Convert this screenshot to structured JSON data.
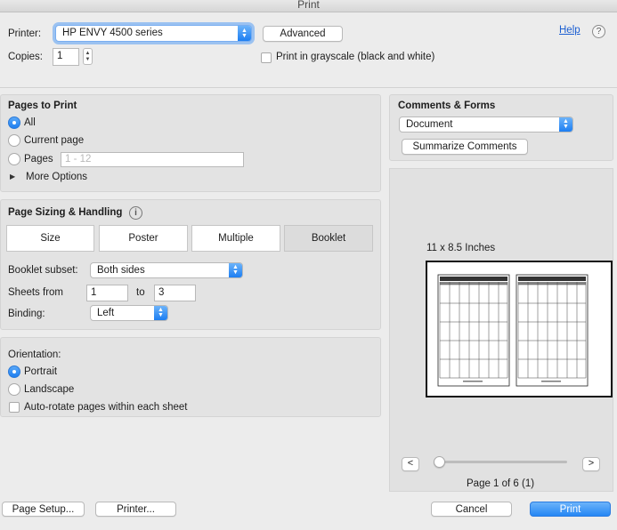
{
  "window": {
    "title": "Print"
  },
  "top": {
    "printer_label": "Printer:",
    "printer_value": "HP ENVY 4500 series",
    "advanced_label": "Advanced",
    "help_label": "Help",
    "help_icon": "?",
    "copies_label": "Copies:",
    "copies_value": "1",
    "grayscale_label": "Print in grayscale (black and white)",
    "grayscale_checked": false
  },
  "pages_to_print": {
    "heading": "Pages to Print",
    "all_label": "All",
    "current_label": "Current page",
    "pages_label": "Pages",
    "pages_placeholder": "1 - 12",
    "more_options_label": "More Options",
    "selected": "All"
  },
  "sizing": {
    "heading": "Page Sizing & Handling",
    "info_icon": "i",
    "tabs": [
      "Size",
      "Poster",
      "Multiple",
      "Booklet"
    ],
    "selected_tab": "Booklet",
    "booklet_subset_label": "Booklet subset:",
    "booklet_subset_value": "Both sides",
    "sheets_from_label": "Sheets from",
    "sheets_from_value": "1",
    "to_label": "to",
    "sheets_to_value": "3",
    "binding_label": "Binding:",
    "binding_value": "Left"
  },
  "orientation": {
    "heading": "Orientation:",
    "portrait_label": "Portrait",
    "landscape_label": "Landscape",
    "autorotate_label": "Auto-rotate pages within each sheet",
    "selected": "Portrait",
    "autorotate_checked": false
  },
  "comments": {
    "heading": "Comments & Forms",
    "value": "Document",
    "summarize_label": "Summarize Comments"
  },
  "preview": {
    "size_label": "11 x 8.5 Inches",
    "prev_label": "<",
    "next_label": ">",
    "page_status": "Page 1 of 6 (1)",
    "page_position": 1,
    "page_total": 6
  },
  "footer": {
    "page_setup_label": "Page Setup...",
    "printer_label": "Printer...",
    "cancel_label": "Cancel",
    "print_label": "Print"
  },
  "colors": {
    "accent": "#2586f4",
    "link": "#1c5fd1"
  }
}
